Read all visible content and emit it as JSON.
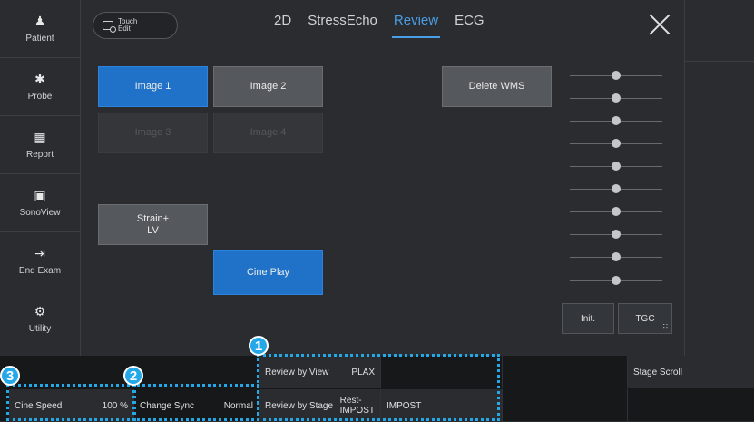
{
  "sidebar": {
    "items": [
      {
        "label": "Patient",
        "icon": "patient-icon"
      },
      {
        "label": "Probe",
        "icon": "probe-icon"
      },
      {
        "label": "Report",
        "icon": "report-icon"
      },
      {
        "label": "SonoView",
        "icon": "sonoview-icon"
      },
      {
        "label": "End Exam",
        "icon": "end-exam-icon"
      },
      {
        "label": "Utility",
        "icon": "utility-icon"
      }
    ]
  },
  "header": {
    "touch_edit_line1": "Touch",
    "touch_edit_line2": "Edit",
    "tabs": [
      "2D",
      "StressEcho",
      "Review",
      "ECG"
    ],
    "active_tab": "Review"
  },
  "buttons": {
    "image1": "Image 1",
    "image2": "Image 2",
    "image3": "Image 3",
    "image4": "Image 4",
    "delete_wms": "Delete WMS",
    "strain_line1": "Strain+",
    "strain_line2": "LV",
    "cine_play": "Cine Play"
  },
  "tgc": {
    "init_label": "Init.",
    "tgc_label": "TGC",
    "slider_count": 10
  },
  "bottom": {
    "review_by_view_label": "Review by View",
    "review_by_view_value": "PLAX",
    "review_by_stage_label": "Review by Stage",
    "review_by_stage_value_line1": "Rest-",
    "review_by_stage_value_line2": "IMPOST",
    "review_by_stage_extra": "IMPOST",
    "stage_scroll": "Stage Scroll",
    "cine_speed_label": "Cine Speed",
    "cine_speed_value": "100 %",
    "change_sync_label": "Change Sync",
    "change_sync_value": "Normal"
  },
  "callouts": [
    "1",
    "2",
    "3"
  ],
  "colors": {
    "accent": "#1f72c8",
    "tab_active": "#4a9ee6",
    "callout": "#25a8e8"
  }
}
